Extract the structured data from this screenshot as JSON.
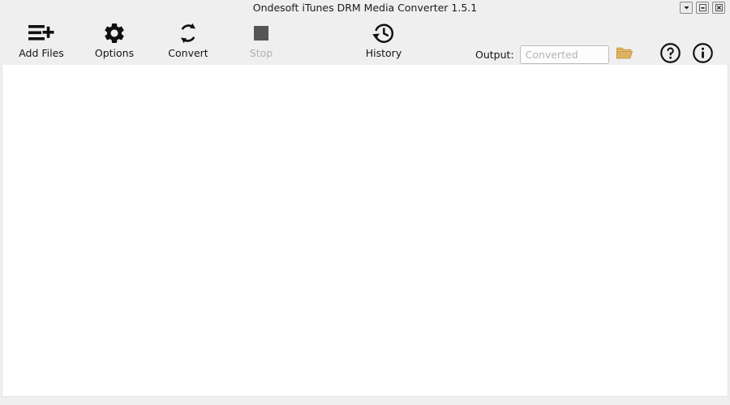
{
  "window": {
    "title": "Ondesoft iTunes DRM Media Converter 1.5.1",
    "controls": [
      {
        "name": "menu-dropdown",
        "icon": "chevron-down-icon",
        "label": ""
      },
      {
        "name": "minimize",
        "icon": "minimize-icon",
        "label": ""
      },
      {
        "name": "close",
        "icon": "close-icon",
        "label": ""
      }
    ]
  },
  "toolbar": {
    "add_files_label": "Add Files",
    "add_files_icon": "add-files-icon",
    "options_label": "Options",
    "options_icon": "gear-icon",
    "convert_label": "Convert",
    "convert_icon": "convert-refresh-icon",
    "stop_label": "Stop",
    "stop_icon": "stop-square-icon",
    "stop_enabled": false,
    "history_label": "History",
    "history_icon": "history-clock-icon",
    "help_icon": "help-circle-icon",
    "info_icon": "info-circle-icon"
  },
  "output": {
    "label": "Output:",
    "value": "",
    "placeholder": "Converted",
    "browse_icon": "folder-open-icon"
  },
  "file_list": {
    "items": [],
    "empty_text": ""
  },
  "colors": {
    "chrome_background": "#efefef",
    "content_background": "#ffffff",
    "icon_dark": "#101010",
    "icon_disabled": "#555555",
    "label_disabled": "#b0b0b0",
    "folder_accent": "#d9a441",
    "input_border": "#bcbcbc",
    "placeholder_text": "#b4b4b4"
  }
}
